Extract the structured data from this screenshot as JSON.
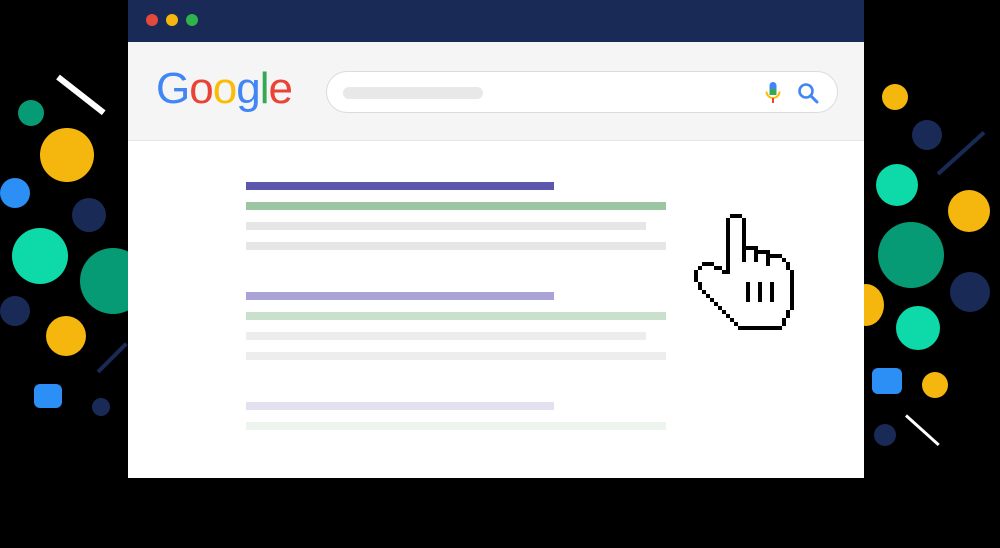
{
  "browser": {
    "window_controls": [
      {
        "name": "close",
        "color": "#e24b3b"
      },
      {
        "name": "minimize",
        "color": "#f5b70d"
      },
      {
        "name": "maximize",
        "color": "#2fb34a"
      }
    ]
  },
  "logo": {
    "letters": [
      {
        "char": "G",
        "color": "#4285F4"
      },
      {
        "char": "o",
        "color": "#EA4335"
      },
      {
        "char": "o",
        "color": "#FBBC05"
      },
      {
        "char": "g",
        "color": "#4285F4"
      },
      {
        "char": "l",
        "color": "#34A853"
      },
      {
        "char": "e",
        "color": "#EA4335"
      }
    ]
  },
  "search": {
    "value": "",
    "mic_icon": "microphone-icon",
    "search_icon": "magnifier-icon"
  },
  "results": [
    {
      "title_color": "#5c57ad",
      "url_color": "#9cc5a3",
      "snippet_color": "#e6e6e6"
    },
    {
      "title_color": "#a9a3d6",
      "url_color": "#c9e0cc",
      "snippet_color": "#ededed"
    },
    {
      "title_color": "#e3e0f2",
      "url_color": "#eef5ef",
      "snippet_color": "#f4f4f4"
    }
  ],
  "cursor": {
    "icon": "pointer-hand-icon"
  },
  "colors": {
    "navy": "#1a2a57",
    "yellow": "#f5b70d",
    "teal": "#0ed9a8",
    "green": "#069b75",
    "blue": "#2b8ff5",
    "background": "#000000"
  }
}
